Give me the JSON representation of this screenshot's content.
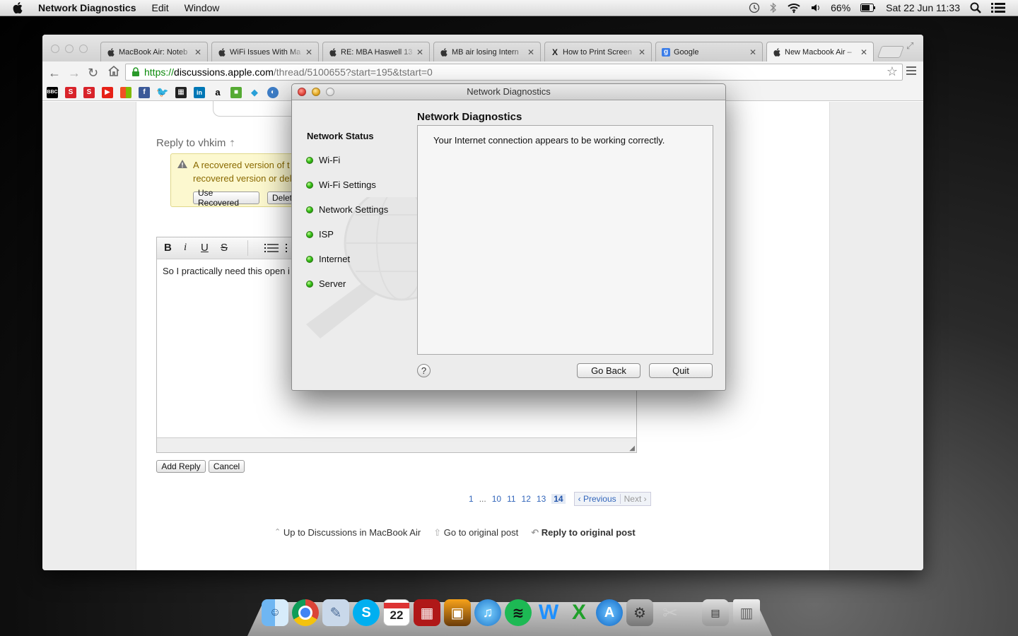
{
  "menubar": {
    "app_name": "Network Diagnostics",
    "menus": [
      "Edit",
      "Window"
    ],
    "battery": "66%",
    "datetime": "Sat 22 Jun  11:33"
  },
  "browser": {
    "tabs": [
      {
        "title": "MacBook Air: Noteb",
        "icon": "apple-icon"
      },
      {
        "title": "WiFi Issues With Ma",
        "icon": "apple-icon"
      },
      {
        "title": "RE: MBA Haswell 13",
        "icon": "apple-icon"
      },
      {
        "title": "MB air losing Intern",
        "icon": "apple-icon"
      },
      {
        "title": "How to Print Screen",
        "icon": "x-icon"
      },
      {
        "title": "Google",
        "icon": "google-icon"
      },
      {
        "title": "New Macbook Air –",
        "icon": "apple-icon"
      }
    ],
    "url": {
      "scheme": "https://",
      "host": "discussions.apple.com",
      "path": "/thread/5100655?start=195&tstart=0"
    }
  },
  "page": {
    "reply_to": "Reply to vhkim",
    "warning_line1": "A recovered version of t",
    "warning_line2": "recovered version or del",
    "use_recovered": "Use Recovered",
    "delete_label": "Delet",
    "editor_text": "So I practically need this open i",
    "add_reply": "Add Reply",
    "cancel": "Cancel",
    "pagination": {
      "first": "1",
      "ellipsis": "...",
      "pages": [
        "10",
        "11",
        "12",
        "13"
      ],
      "current": "14",
      "previous": "Previous",
      "next": "Next"
    },
    "footer": {
      "up": "Up to Discussions in MacBook Air",
      "original": "Go to original post",
      "reply": "Reply to original post"
    }
  },
  "dialog": {
    "window_title": "Network Diagnostics",
    "heading": "Network Diagnostics",
    "status_heading": "Network Status",
    "status_items": [
      "Wi-Fi",
      "Wi-Fi Settings",
      "Network Settings",
      "ISP",
      "Internet",
      "Server"
    ],
    "status_color": "#38c21a",
    "message": "Your Internet connection appears to be working correctly.",
    "help": "?",
    "go_back": "Go Back",
    "quit": "Quit"
  },
  "dock": {
    "apps": [
      "finder-icon",
      "chrome-icon",
      "preview-icon",
      "skype-icon",
      "calendar-icon",
      "photo-booth-icon",
      "iphoto-icon",
      "itunes-icon",
      "spotify-icon",
      "word-icon",
      "excel-icon",
      "app-store-icon",
      "system-preferences-icon",
      "utilities-icon",
      "network-icon",
      "trash-icon"
    ],
    "calendar_day": "22"
  }
}
